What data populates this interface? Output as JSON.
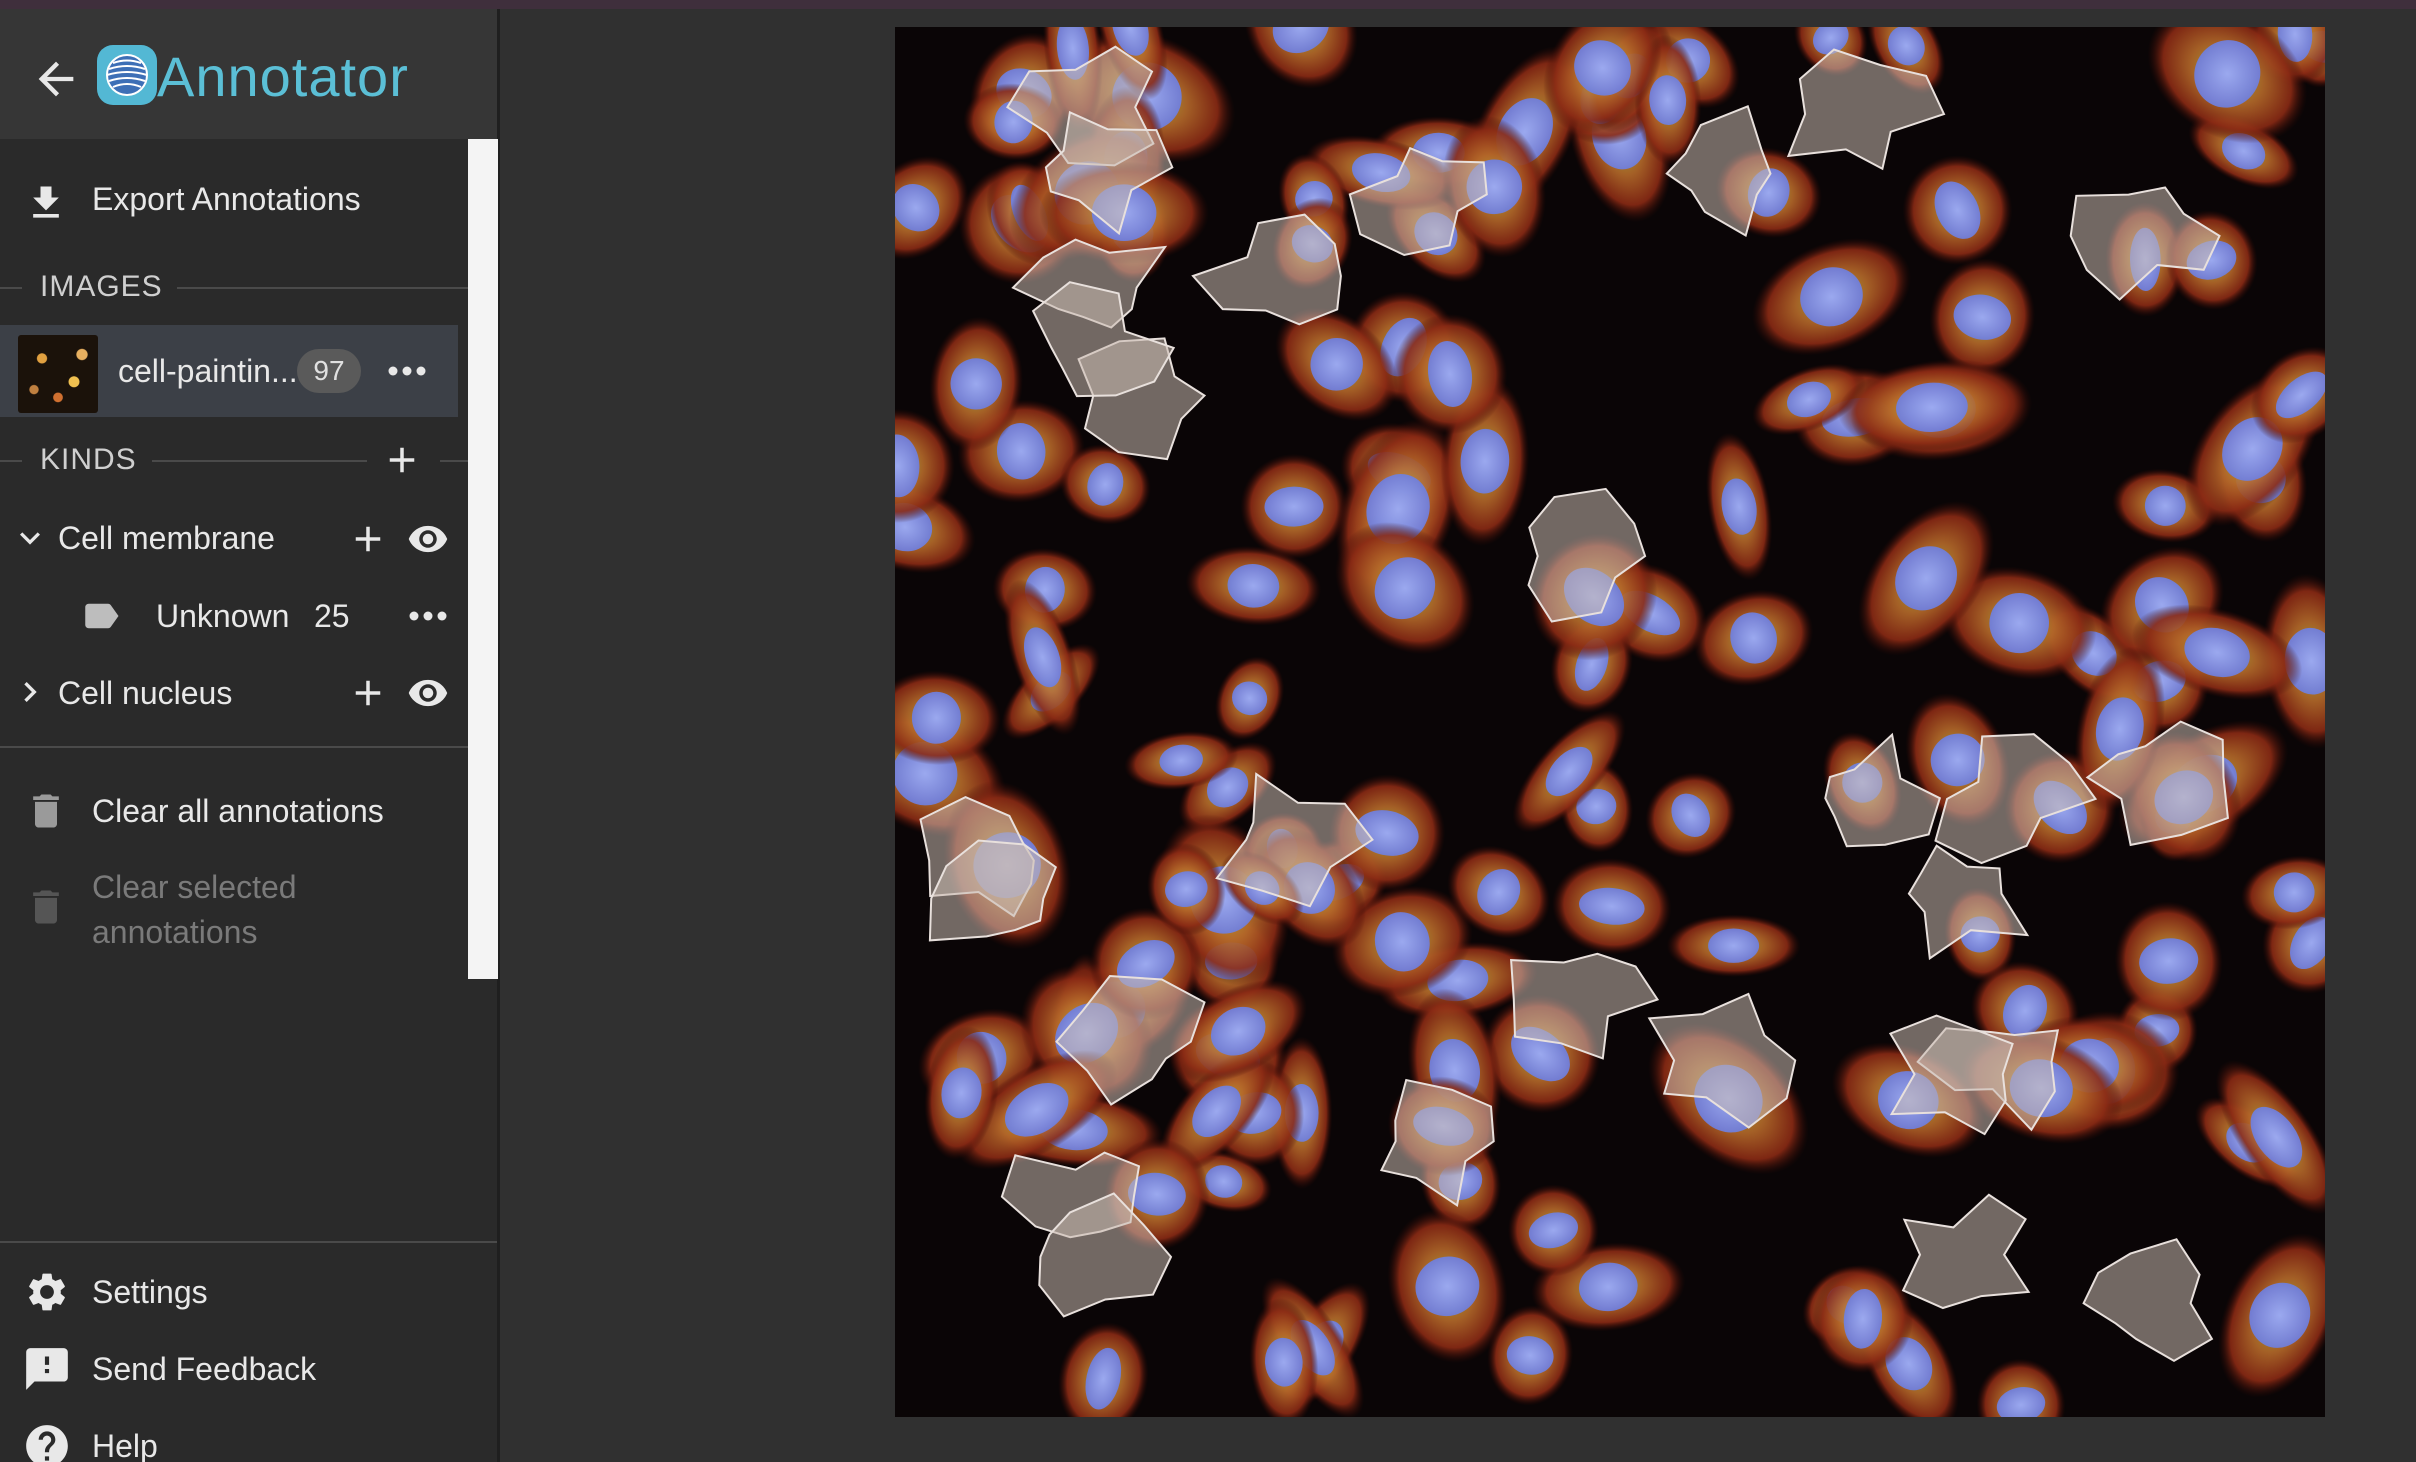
{
  "app": {
    "title": "Annotator"
  },
  "sidebar": {
    "export_label": "Export Annotations",
    "images_title": "IMAGES",
    "image_item": {
      "name": "cell-paintin...",
      "count": "97"
    },
    "kinds_title": "KINDS",
    "kinds": [
      {
        "label": "Cell membrane",
        "expanded": true,
        "categories": [
          {
            "label": "Unknown",
            "count": "25"
          }
        ]
      },
      {
        "label": "Cell nucleus",
        "expanded": false
      }
    ],
    "clear_all_label": "Clear all annotations",
    "clear_selected_label_line1": "Clear selected",
    "clear_selected_label_line2": "annotations",
    "footer": {
      "settings_label": "Settings",
      "feedback_label": "Send Feedback",
      "help_label": "Help"
    }
  },
  "colors": {
    "accent": "#5bbfd6",
    "sidebar_bg": "#2a2a2a",
    "header_bg": "#363636",
    "selected_item_bg": "#3c4047",
    "main_bg": "#303030"
  }
}
